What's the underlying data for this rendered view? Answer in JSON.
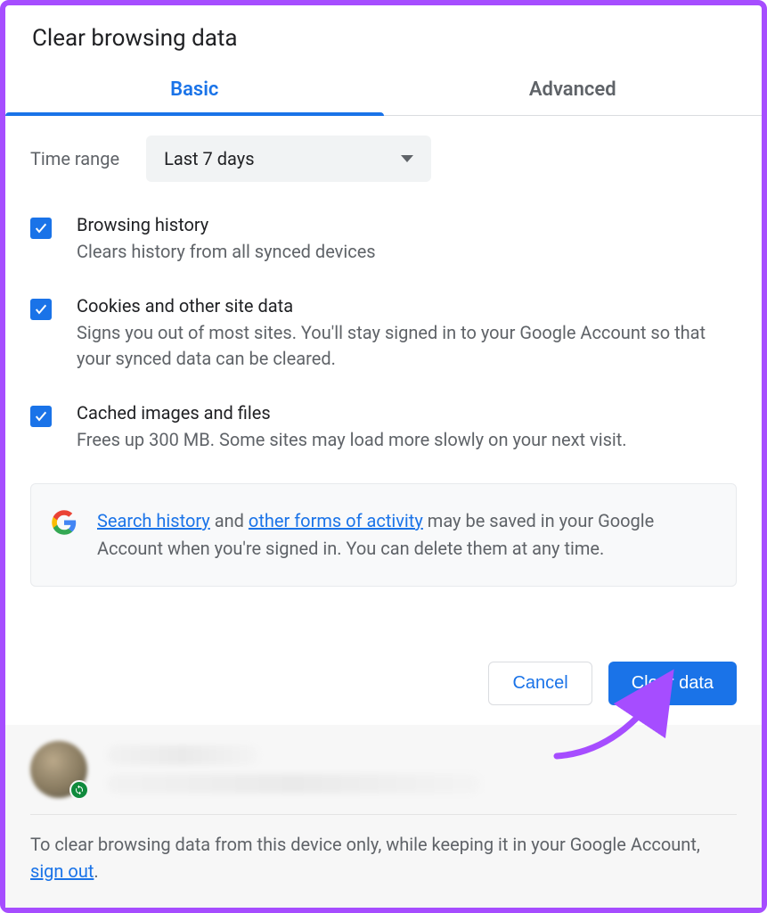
{
  "dialog": {
    "title": "Clear browsing data",
    "tabs": {
      "basic": "Basic",
      "advanced": "Advanced"
    },
    "time_range": {
      "label": "Time range",
      "selected": "Last 7 days"
    },
    "options": [
      {
        "title": "Browsing history",
        "desc": "Clears history from all synced devices",
        "checked": true
      },
      {
        "title": "Cookies and other site data",
        "desc": "Signs you out of most sites. You'll stay signed in to your Google Account so that your synced data can be cleared.",
        "checked": true
      },
      {
        "title": "Cached images and files",
        "desc": "Frees up 300 MB. Some sites may load more slowly on your next visit.",
        "checked": true
      }
    ],
    "info": {
      "link1": "Search history",
      "mid1": " and ",
      "link2": "other forms of activity",
      "rest": " may be saved in your Google Account when you're signed in. You can delete them at any time."
    },
    "actions": {
      "cancel": "Cancel",
      "clear": "Clear data"
    },
    "footer": {
      "pre": "To clear browsing data from this device only, while keeping it in your Google Account, ",
      "link": "sign out",
      "post": "."
    }
  }
}
